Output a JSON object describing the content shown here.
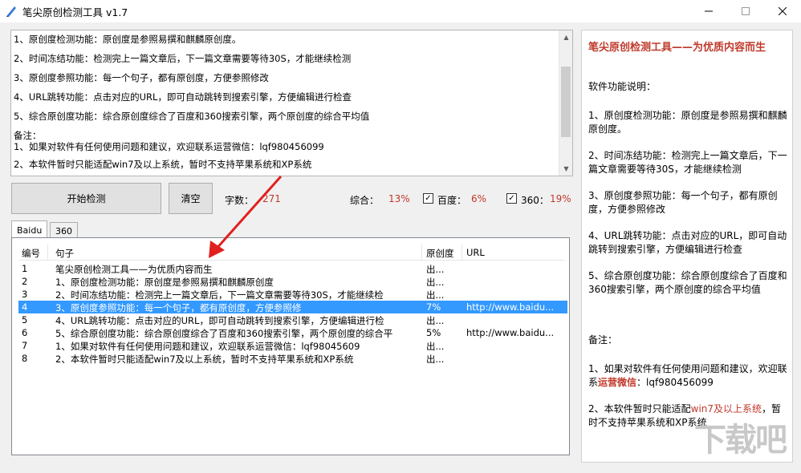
{
  "window": {
    "title": "笔尖原创检测工具 v1.7"
  },
  "editor": {
    "lines": [
      "1、原创度检测功能：原创度是参照易撰和麒麟原创度。",
      "2、时间冻结功能：检测完上一篇文章后，下一篇文章需要等待30S，才能继续检测",
      "3、原创度参照功能：每一个句子，都有原创度，方便参照修改",
      "4、URL跳转功能：点击对应的URL，即可自动跳转到搜索引擎，方便编辑进行检查",
      "5、综合原创度功能：综合原创度综合了百度和360搜索引擎，两个原创度的综合平均值",
      "备注：",
      "1、如果对软件有任何使用问题和建议，欢迎联系运营微信：lqf980456099",
      "2、本软件暂时只能适配win7及以上系统，暂时不支持苹果系统和XP系统"
    ]
  },
  "toolbar": {
    "start_label": "开始检测",
    "clear_label": "清空",
    "wordcount_label": "字数：",
    "wordcount_value": "271",
    "total_label": "综合：",
    "total_value": "13%",
    "baidu_label": "百度：",
    "baidu_value": "6%",
    "s360_label": "360：",
    "s360_value": "19%",
    "baidu_checked": "✓",
    "s360_checked": "✓"
  },
  "tabs": [
    "Baidu",
    "360"
  ],
  "grid": {
    "headers": [
      "编号",
      "句子",
      "原创度",
      "URL"
    ],
    "rows": [
      [
        "1",
        "笔尖原创检测工具——为优质内容而生",
        "出...",
        ""
      ],
      [
        "2",
        "1、原创度检测功能：原创度是参照易撰和麒麟原创度",
        "出...",
        ""
      ],
      [
        "3",
        "2、时间冻结功能：检测完上一篇文章后，下一篇文章需要等待30S，才能继续检",
        "出...",
        ""
      ],
      [
        "4",
        "3、原创度参照功能：每一个句子，都有原创度，方便参照修",
        "7%",
        "http://www.baidu..."
      ],
      [
        "5",
        "4、URL跳转功能：点击对应的URL，即可自动跳转到搜索引擎，方便编辑进行检",
        "出...",
        ""
      ],
      [
        "6",
        "5、综合原创度功能：综合原创度综合了百度和360搜索引擎，两个原创度的综合平",
        "5%",
        "http://www.baidu..."
      ],
      [
        "7",
        "1、如果对软件有任何使用问题和建议，欢迎联系运营微信：lqf98045609",
        "出...",
        ""
      ],
      [
        "8",
        "2、本软件暂时只能适配win7及以上系统，暂时不支持苹果系统和XP系统",
        "出...",
        ""
      ]
    ]
  },
  "panel": {
    "heading": "笔尖原创检测工具——为优质内容而生",
    "desc_title": "软件功能说明：",
    "items": [
      "1、原创度检测功能：原创度是参照易撰和麒麟原创度。",
      "2、时间冻结功能：检测完上一篇文章后，下一篇文章需要等待30S，才能继续检测",
      "3、原创度参照功能：每一个句子，都有原创度，方便参照修改",
      "4、URL跳转功能：点击对应的URL，即可自动跳转到搜索引擎，方便编辑进行检查",
      "5、综合原创度功能：综合原创度综合了百度和360搜索引擎，两个原创度的综合平均值"
    ],
    "note_title": "备注：",
    "note1_a": "1、如果对软件有任何使用问题和建议，欢迎联系",
    "note1_b": "运营微信",
    "note1_c": "：lqf980456099",
    "note2_a": "2、本软件暂时只能适配",
    "note2_b": "win7及以上系统",
    "note2_c": "，暂时不支持苹果系统和XP系统"
  },
  "watermark": "下载吧"
}
